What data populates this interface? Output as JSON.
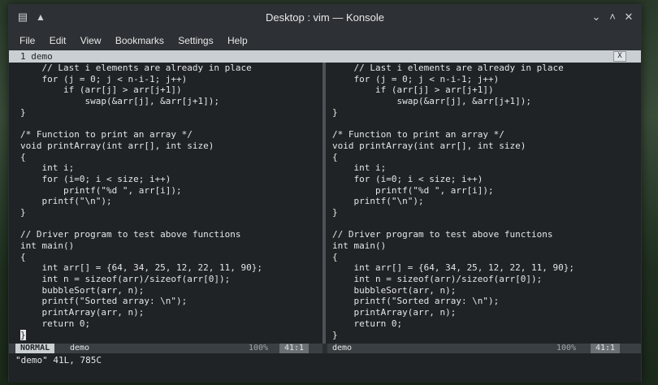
{
  "window": {
    "title": "Desktop : vim — Konsole"
  },
  "menu": [
    "File",
    "Edit",
    "View",
    "Bookmarks",
    "Settings",
    "Help"
  ],
  "tab": {
    "label": "1 demo",
    "close": "X"
  },
  "code_lines": [
    "    // Last i elements are already in place",
    "    for (j = 0; j < n-i-1; j++)",
    "        if (arr[j] > arr[j+1])",
    "            swap(&arr[j], &arr[j+1]);",
    "}",
    "",
    "/* Function to print an array */",
    "void printArray(int arr[], int size)",
    "{",
    "    int i;",
    "    for (i=0; i < size; i++)",
    "        printf(\"%d \", arr[i]);",
    "    printf(\"\\n\");",
    "}",
    "",
    "// Driver program to test above functions",
    "int main()",
    "{",
    "    int arr[] = {64, 34, 25, 12, 22, 11, 90};",
    "    int n = sizeof(arr)/sizeof(arr[0]);",
    "    bubbleSort(arr, n);",
    "    printf(\"Sorted array: \\n\");",
    "    printArray(arr, n);",
    "    return 0;",
    "}"
  ],
  "status": {
    "mode": "NORMAL",
    "left_file": "demo",
    "left_percent": "100%",
    "left_position": "41:1",
    "right_file": "demo",
    "right_percent": "100%",
    "right_position": "41:1",
    "message": "\"demo\" 41L, 785C"
  },
  "colors": {
    "titlebar": "#2d3135",
    "editor_bg": "#1f2326",
    "tabbar": "#c9cfd2"
  }
}
